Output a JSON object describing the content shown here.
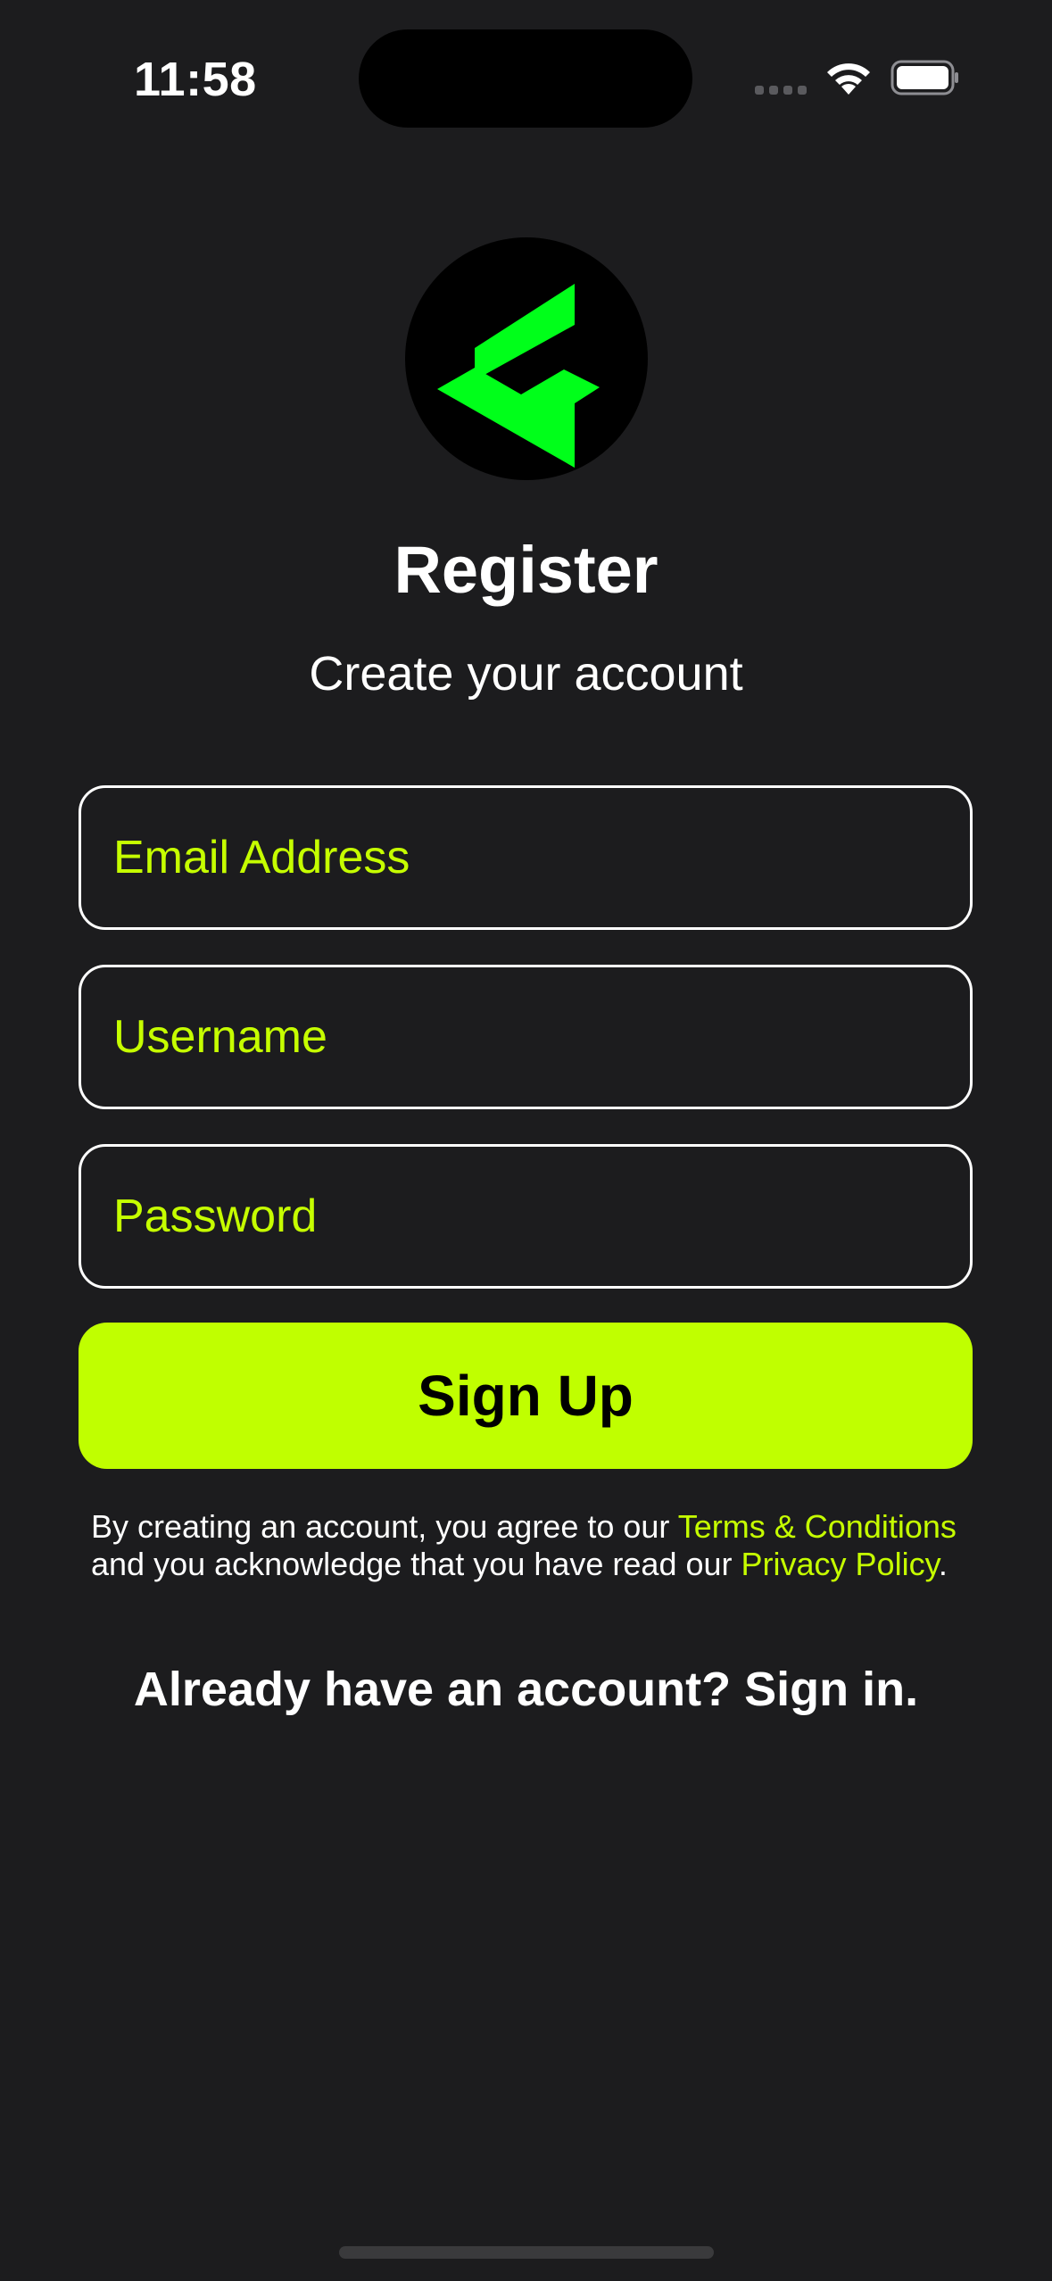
{
  "status_bar": {
    "time": "11:58"
  },
  "header": {
    "title": "Register",
    "subtitle": "Create your account"
  },
  "form": {
    "email_placeholder": "Email Address",
    "username_placeholder": "Username",
    "password_placeholder": "Password",
    "email_value": "",
    "username_value": "",
    "password_value": ""
  },
  "actions": {
    "signup_label": "Sign Up",
    "signin_prompt": "Already have an account? Sign in."
  },
  "legal": {
    "text_before_terms": "By creating an account, you agree to our ",
    "terms_link": "Terms & Conditions",
    "text_middle": " and you acknowledge that you have read our ",
    "privacy_link": "Privacy Policy",
    "text_end": "."
  },
  "icons": {
    "logo": "brand-logo-icon",
    "wifi": "wifi-icon",
    "battery": "battery-icon",
    "signal": "cellular-signal-icon"
  },
  "colors": {
    "background": "#1c1c1e",
    "accent": "#c0ff00",
    "logo_green": "#00ff1a"
  }
}
